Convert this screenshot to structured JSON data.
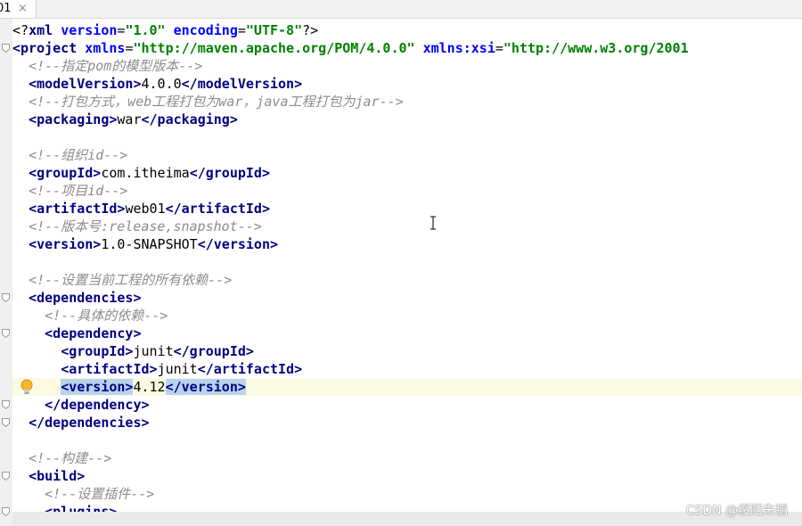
{
  "tab": {
    "label": "01",
    "close_glyph": "×"
  },
  "editor": {
    "lines": [
      {
        "tokens": [
          {
            "t": "pi",
            "v": "<?"
          },
          {
            "t": "tg",
            "v": "xml "
          },
          {
            "t": "at",
            "v": "version"
          },
          {
            "t": "pi",
            "v": "="
          },
          {
            "t": "av",
            "v": "\"1.0\""
          },
          {
            "t": "pi",
            "v": " "
          },
          {
            "t": "at",
            "v": "encoding"
          },
          {
            "t": "pi",
            "v": "="
          },
          {
            "t": "av",
            "v": "\"UTF-8\""
          },
          {
            "t": "pi",
            "v": "?>"
          }
        ]
      },
      {
        "tokens": [
          {
            "t": "tg",
            "v": "<project "
          },
          {
            "t": "at",
            "v": "xmlns"
          },
          {
            "t": "pi",
            "v": "="
          },
          {
            "t": "av",
            "v": "\"http://maven.apache.org/POM/4.0.0\""
          },
          {
            "t": "pi",
            "v": " "
          },
          {
            "t": "at",
            "v": "xmlns:xsi"
          },
          {
            "t": "pi",
            "v": "="
          },
          {
            "t": "av",
            "v": "\"http://www.w3.org/2001"
          }
        ]
      },
      {
        "tokens": [
          {
            "t": "pi",
            "v": "  "
          },
          {
            "t": "cm",
            "v": "<!--指定pom的模型版本-->"
          }
        ]
      },
      {
        "tokens": [
          {
            "t": "pi",
            "v": "  "
          },
          {
            "t": "tg",
            "v": "<modelVersion>"
          },
          {
            "t": "pi",
            "v": "4.0.0"
          },
          {
            "t": "tg",
            "v": "</modelVersion>"
          }
        ]
      },
      {
        "tokens": [
          {
            "t": "pi",
            "v": "  "
          },
          {
            "t": "cm",
            "v": "<!--打包方式，web工程打包为war，java工程打包为jar-->"
          }
        ]
      },
      {
        "tokens": [
          {
            "t": "pi",
            "v": "  "
          },
          {
            "t": "tg",
            "v": "<packaging>"
          },
          {
            "t": "pi",
            "v": "war"
          },
          {
            "t": "tg",
            "v": "</packaging>"
          }
        ]
      },
      {
        "tokens": []
      },
      {
        "tokens": [
          {
            "t": "pi",
            "v": "  "
          },
          {
            "t": "cm",
            "v": "<!--组织id-->"
          }
        ]
      },
      {
        "tokens": [
          {
            "t": "pi",
            "v": "  "
          },
          {
            "t": "tg",
            "v": "<groupId>"
          },
          {
            "t": "pi",
            "v": "com.itheima"
          },
          {
            "t": "tg",
            "v": "</groupId>"
          }
        ]
      },
      {
        "tokens": [
          {
            "t": "pi",
            "v": "  "
          },
          {
            "t": "cm",
            "v": "<!--项目id-->"
          }
        ]
      },
      {
        "tokens": [
          {
            "t": "pi",
            "v": "  "
          },
          {
            "t": "tg",
            "v": "<artifactId>"
          },
          {
            "t": "pi",
            "v": "web01"
          },
          {
            "t": "tg",
            "v": "</artifactId>"
          }
        ]
      },
      {
        "tokens": [
          {
            "t": "pi",
            "v": "  "
          },
          {
            "t": "cm",
            "v": "<!--版本号:release,snapshot-->"
          }
        ]
      },
      {
        "tokens": [
          {
            "t": "pi",
            "v": "  "
          },
          {
            "t": "tg",
            "v": "<version>"
          },
          {
            "t": "pi",
            "v": "1.0-SNAPSHOT"
          },
          {
            "t": "tg",
            "v": "</version>"
          }
        ]
      },
      {
        "tokens": []
      },
      {
        "tokens": [
          {
            "t": "pi",
            "v": "  "
          },
          {
            "t": "cm",
            "v": "<!--设置当前工程的所有依赖-->"
          }
        ]
      },
      {
        "tokens": [
          {
            "t": "pi",
            "v": "  "
          },
          {
            "t": "tg",
            "v": "<dependencies>"
          }
        ]
      },
      {
        "tokens": [
          {
            "t": "pi",
            "v": "    "
          },
          {
            "t": "cm",
            "v": "<!--具体的依赖-->"
          }
        ]
      },
      {
        "tokens": [
          {
            "t": "pi",
            "v": "    "
          },
          {
            "t": "tg",
            "v": "<dependency>"
          }
        ]
      },
      {
        "tokens": [
          {
            "t": "pi",
            "v": "      "
          },
          {
            "t": "tg",
            "v": "<groupId>"
          },
          {
            "t": "pi",
            "v": "junit"
          },
          {
            "t": "tg",
            "v": "</groupId>"
          }
        ]
      },
      {
        "tokens": [
          {
            "t": "pi",
            "v": "      "
          },
          {
            "t": "tg",
            "v": "<artifactId>"
          },
          {
            "t": "pi",
            "v": "junit"
          },
          {
            "t": "tg",
            "v": "</artifactId>"
          }
        ]
      },
      {
        "highlight": true,
        "tokens": [
          {
            "t": "pi",
            "v": "      "
          },
          {
            "t": "tg",
            "v": "<version>",
            "sel": true
          },
          {
            "t": "pi",
            "v": "4.12"
          },
          {
            "t": "tg",
            "v": "</version>",
            "sel": true
          }
        ]
      },
      {
        "tokens": [
          {
            "t": "pi",
            "v": "    "
          },
          {
            "t": "tg",
            "v": "</dependency>"
          }
        ]
      },
      {
        "tokens": [
          {
            "t": "pi",
            "v": "  "
          },
          {
            "t": "tg",
            "v": "</dependencies>"
          }
        ]
      },
      {
        "tokens": []
      },
      {
        "tokens": [
          {
            "t": "pi",
            "v": "  "
          },
          {
            "t": "cm",
            "v": "<!--构建-->"
          }
        ]
      },
      {
        "tokens": [
          {
            "t": "pi",
            "v": "  "
          },
          {
            "t": "tg",
            "v": "<build>"
          }
        ]
      },
      {
        "tokens": [
          {
            "t": "pi",
            "v": "    "
          },
          {
            "t": "cm",
            "v": "<!--设置插件-->"
          }
        ]
      },
      {
        "tokens": [
          {
            "t": "pi",
            "v": "    "
          },
          {
            "t": "tg",
            "v": "<plugins>"
          }
        ]
      }
    ],
    "fold_marker_lines": [
      1,
      15,
      17,
      21,
      22,
      25,
      27
    ],
    "intention_bulb_line": 20
  },
  "watermark": {
    "text": "CSDN @绥阳朱韬"
  },
  "colors": {
    "tag": "#000080",
    "attr_name": "#0000ff",
    "attr_value": "#008000",
    "comment": "#8c8c8c",
    "selection": "#b9d3ee",
    "current_line": "#fbfae3"
  }
}
